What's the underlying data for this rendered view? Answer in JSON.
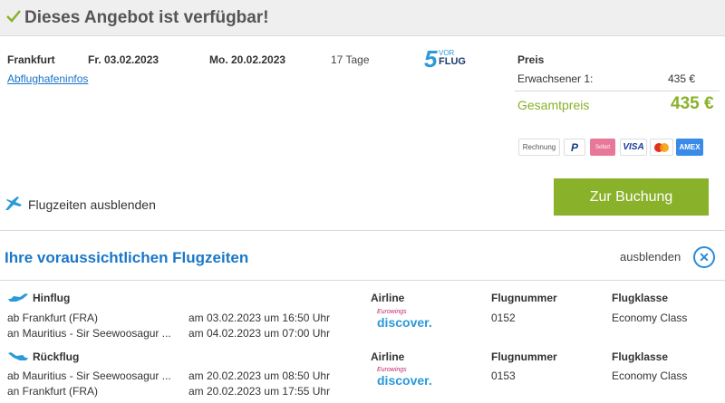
{
  "header": {
    "title": "Dieses Angebot ist verfügbar!"
  },
  "trip": {
    "origin": "Frankfurt",
    "departure": "Fr. 03.02.2023",
    "return": "Mo. 20.02.2023",
    "duration": "17 Tage",
    "airport_info_link": "Abflughafeninfos",
    "operator_logo": {
      "number": "5",
      "line1": "VOR",
      "line2": "FLUG"
    }
  },
  "price": {
    "label": "Preis",
    "adult_label": "Erwachsener 1:",
    "adult_value": "435 €",
    "total_label": "Gesamtpreis",
    "total_value": "435 €"
  },
  "payment_methods": [
    "Rechnung",
    "PayPal",
    "Sofort",
    "VISA",
    "Mastercard",
    "AMEX"
  ],
  "payment_labels": {
    "rechnung": "Rechnung",
    "visa": "VISA",
    "amex": "AMEX",
    "paypal": "P",
    "sofort": "Sofort"
  },
  "flight_toggle": {
    "label": "Flugzeiten ausblenden"
  },
  "book_button": {
    "label": "Zur Buchung"
  },
  "flight_times": {
    "title": "Ihre voraussichtlichen Flugzeiten",
    "hide_label": "ausblenden",
    "columns": {
      "airline": "Airline",
      "flight_number": "Flugnummer",
      "flight_class": "Flugklasse"
    },
    "outbound": {
      "label": "Hinflug",
      "from": "ab Frankfurt (FRA)",
      "to": "an Mauritius - Sir Seewoosagur ...",
      "dep_time": "am 03.02.2023 um 16:50 Uhr",
      "arr_time": "am 04.02.2023 um 07:00 Uhr",
      "airline_small": "Eurowings",
      "airline_big": "discover.",
      "flight_number": "0152",
      "class": "Economy Class"
    },
    "return": {
      "label": "Rückflug",
      "from": "ab Mauritius - Sir Seewoosagur ...",
      "to": "an Frankfurt (FRA)",
      "dep_time": "am 20.02.2023 um 08:50 Uhr",
      "arr_time": "am 20.02.2023 um 17:55 Uhr",
      "airline_small": "Eurowings",
      "airline_big": "discover.",
      "flight_number": "0153",
      "class": "Economy Class"
    }
  },
  "colors": {
    "accent_green": "#8ab12a",
    "accent_blue": "#1a78c8",
    "link": "#1a73c8"
  }
}
